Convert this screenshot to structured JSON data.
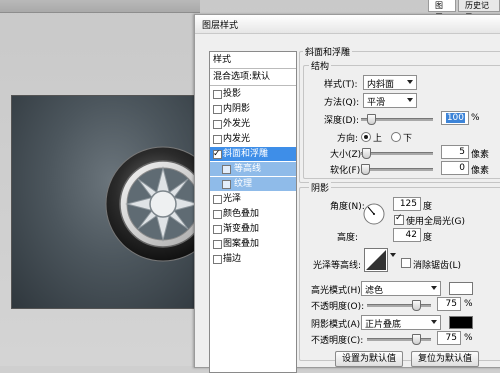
{
  "app": {
    "panel_tabs": [
      "图层",
      "历史记录"
    ],
    "dialog_title": "图层样式"
  },
  "style_list": {
    "header": "样式",
    "blend_options": "混合选项:默认",
    "items": [
      {
        "label": "投影",
        "checked": false
      },
      {
        "label": "内阴影",
        "checked": false
      },
      {
        "label": "外发光",
        "checked": false
      },
      {
        "label": "内发光",
        "checked": false
      },
      {
        "label": "斜面和浮雕",
        "checked": true,
        "selected": true
      },
      {
        "label": "等高线",
        "checked": false,
        "sub": true
      },
      {
        "label": "纹理",
        "checked": false,
        "sub": true
      },
      {
        "label": "光泽",
        "checked": false
      },
      {
        "label": "颜色叠加",
        "checked": false
      },
      {
        "label": "渐变叠加",
        "checked": false
      },
      {
        "label": "图案叠加",
        "checked": false
      },
      {
        "label": "描边",
        "checked": false
      }
    ]
  },
  "bevel": {
    "group_title": "斜面和浮雕",
    "structure_title": "结构",
    "style_label": "样式(T):",
    "style_value": "内斜面",
    "technique_label": "方法(Q):",
    "technique_value": "平滑",
    "depth_label": "深度(D):",
    "depth_value": "100",
    "depth_unit": "%",
    "direction_label": "方向:",
    "direction_up": "上",
    "direction_down": "下",
    "direction_selected": "up",
    "size_label": "大小(Z):",
    "size_value": "5",
    "size_unit": "像素",
    "soften_label": "软化(F):",
    "soften_value": "0",
    "soften_unit": "像素"
  },
  "shading": {
    "group_title": "阴影",
    "angle_label": "角度(N):",
    "angle_value": "125",
    "angle_unit": "度",
    "global_light_label": "使用全局光(G)",
    "global_light_checked": true,
    "altitude_label": "高度:",
    "altitude_value": "42",
    "altitude_unit": "度",
    "gloss_contour_label": "光泽等高线:",
    "anti_alias_label": "消除锯齿(L)",
    "anti_alias_checked": false,
    "highlight_mode_label": "高光模式(H):",
    "highlight_mode_value": "滤色",
    "highlight_color": "#ffffff",
    "highlight_opacity_label": "不透明度(O):",
    "highlight_opacity_value": "75",
    "highlight_opacity_unit": "%",
    "shadow_mode_label": "阴影模式(A):",
    "shadow_mode_value": "正片叠底",
    "shadow_color": "#000000",
    "shadow_opacity_label": "不透明度(C):",
    "shadow_opacity_value": "75",
    "shadow_opacity_unit": "%"
  },
  "buttons": {
    "make_default": "设置为默认值",
    "reset_default": "复位为默认值"
  },
  "colors": {
    "selection": "#3e8ee8",
    "sub_selection": "#8fbbe9"
  }
}
